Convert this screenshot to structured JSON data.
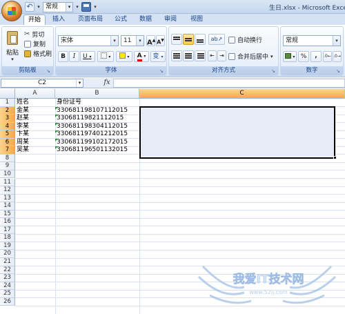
{
  "titlebar": {
    "number_format": "常规",
    "title": "生日.xlsx - Microsoft Excel"
  },
  "tabs": [
    "开始",
    "插入",
    "页面布局",
    "公式",
    "数据",
    "审阅",
    "视图"
  ],
  "clipboard": {
    "paste": "粘贴",
    "cut": "剪切",
    "copy": "复制",
    "format_painter": "格式刷",
    "label": "剪贴板"
  },
  "font": {
    "name": "宋体",
    "size": "11",
    "bold": "B",
    "italic": "I",
    "underline": "U",
    "label": "字体",
    "grow": "A",
    "shrink": "A",
    "font_color": "A",
    "phonetic": "变"
  },
  "alignment": {
    "wrap": "自动换行",
    "merge": "合并后居中",
    "label": "对齐方式"
  },
  "number": {
    "format": "常规",
    "percent": "%",
    "comma": ",",
    "label": "数字"
  },
  "formula_bar": {
    "name_box": "C2",
    "fx": "fx",
    "content": ""
  },
  "columns": [
    "A",
    "B",
    "C"
  ],
  "rows": [
    "1",
    "2",
    "3",
    "4",
    "5",
    "6",
    "7",
    "8",
    "9",
    "10",
    "11",
    "12",
    "13",
    "14",
    "15",
    "16",
    "17",
    "18",
    "19",
    "20",
    "21",
    "22",
    "23",
    "24",
    "25",
    "26"
  ],
  "cells": [
    {
      "a": "姓名",
      "b": "身份证号"
    },
    {
      "a": "金某",
      "b": "330681198107112015"
    },
    {
      "a": "赵某",
      "b": "33068119821112015"
    },
    {
      "a": "李某",
      "b": "330681198304112015"
    },
    {
      "a": "卞某",
      "b": "330681197401212015"
    },
    {
      "a": "周某",
      "b": "330681199102172015"
    },
    {
      "a": "吴某",
      "b": "330681196501132015"
    }
  ],
  "watermark": {
    "main": "我爱IT技术网",
    "url": "www.52ij.com"
  }
}
